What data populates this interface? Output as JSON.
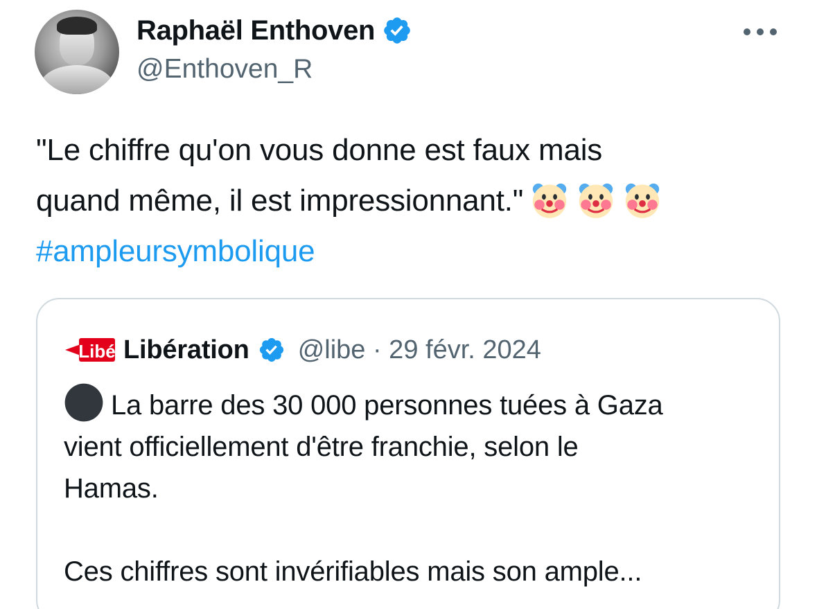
{
  "author": {
    "display_name": "Raphaël Enthoven",
    "handle": "@Enthoven_R",
    "verified_icon": "verified-badge-icon",
    "avatar": "avatar"
  },
  "more_icon": "more-options-icon",
  "tweet": {
    "line1": "\"Le chiffre qu'on vous donne est faux mais",
    "line2": "quand même, il est impressionnant.\"",
    "emoji": [
      "clown-face-icon",
      "clown-face-icon",
      "clown-face-icon"
    ],
    "hashtag": "#ampleursymbolique"
  },
  "quoted_tweet": {
    "logo_icon": "liberation-logo-icon",
    "display_name": "Libération",
    "verified_icon": "verified-badge-icon",
    "handle_date": "@libe · 29 févr. 2024",
    "bullet_icon": "black-circle-icon",
    "text_line1": "La barre des 30 000 personnes tuées à Gaza",
    "text_line2": "vient officiellement d'être franchie, selon le",
    "text_line3": "Hamas.",
    "text_line4": "Ces chiffres sont invérifiables mais son ample..."
  },
  "colors": {
    "accent": "#1d9bf0",
    "text": "#0f1419",
    "secondary_text": "#536471",
    "border": "#cfd9de",
    "liberation_red": "#e2001a"
  }
}
